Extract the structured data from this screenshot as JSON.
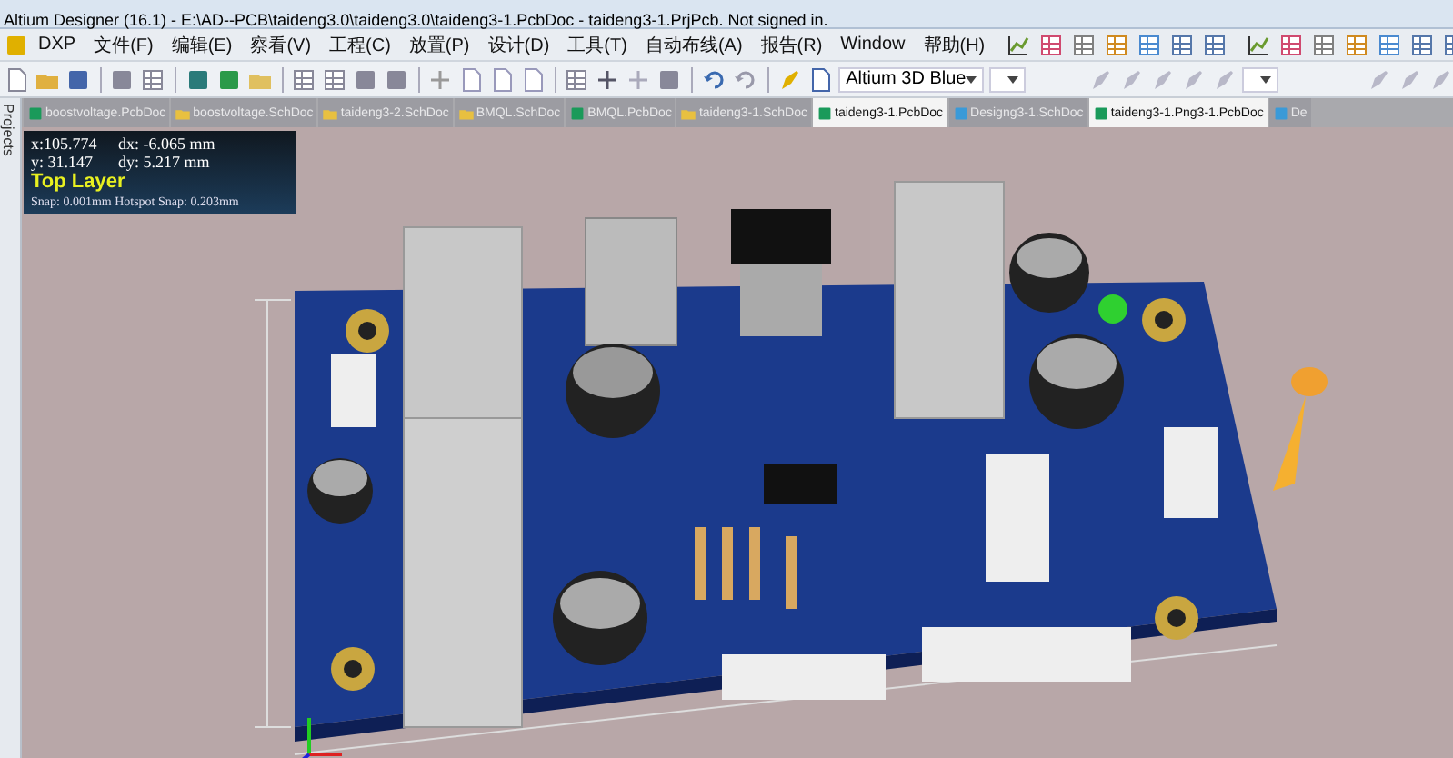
{
  "window": {
    "title": "Altium Designer (16.1) - E:\\AD--PCB\\taideng3.0\\taideng3.0\\taideng3-1.PcbDoc - taideng3-1.PrjPcb. Not signed in."
  },
  "menu": [
    "DXP",
    "文件(F)",
    "编辑(E)",
    "察看(V)",
    "工程(C)",
    "放置(P)",
    "设计(D)",
    "工具(T)",
    "自动布线(A)",
    "报告(R)",
    "Window",
    "帮助(H)"
  ],
  "toolbar": {
    "view_config": "Altium 3D Blue"
  },
  "side_panel": {
    "label": "Projects"
  },
  "tabs": [
    {
      "label": "boostvoltage.PcbDoc",
      "kind": "pcb",
      "selected": false
    },
    {
      "label": "boostvoltage.SchDoc",
      "kind": "sch",
      "selected": false
    },
    {
      "label": "taideng3-2.SchDoc",
      "kind": "sch",
      "selected": false
    },
    {
      "label": "BMQL.SchDoc",
      "kind": "sch",
      "selected": false
    },
    {
      "label": "BMQL.PcbDoc",
      "kind": "pcb",
      "selected": false
    },
    {
      "label": "taideng3-1.SchDoc",
      "kind": "sch",
      "selected": false
    },
    {
      "label": "taideng3-1.PcbDoc",
      "kind": "pcb",
      "selected": true
    },
    {
      "label": "Designg3-1.SchDoc",
      "kind": "design",
      "selected": false
    },
    {
      "label": "taideng3-1.Png3-1.PcbDoc",
      "kind": "pcb",
      "selected": true
    },
    {
      "label": "De",
      "kind": "design",
      "selected": false
    }
  ],
  "info": {
    "x": "x:105.774",
    "dx": "dx: -6.065 mm",
    "y": "y: 31.147",
    "dy": "dy: 5.217 mm",
    "layer": "Top Layer",
    "snap": "Snap: 0.001mm Hotspot Snap: 0.203mm"
  }
}
